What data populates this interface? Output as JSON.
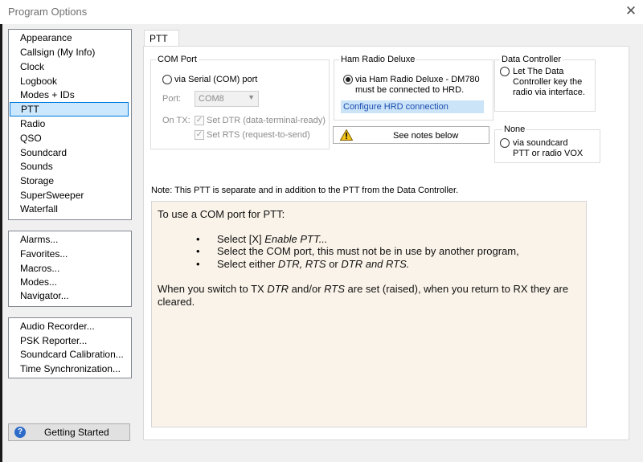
{
  "window": {
    "title": "Program Options",
    "close_glyph": "✕"
  },
  "nav_lists": {
    "main": [
      "Appearance",
      "Callsign (My Info)",
      "Clock",
      "Logbook",
      "Modes + IDs",
      "PTT",
      "Radio",
      "QSO",
      "Soundcard",
      "Sounds",
      "Storage",
      "SuperSweeper",
      "Waterfall"
    ],
    "selected": "PTT",
    "dialogs": [
      "Alarms...",
      "Favorites...",
      "Macros...",
      "Modes...",
      "Navigator..."
    ],
    "tools": [
      "Audio Recorder...",
      "PSK Reporter...",
      "Soundcard Calibration...",
      "Time Synchronization..."
    ]
  },
  "getting_started": {
    "label": "Getting Started",
    "icon": "help-icon",
    "icon_glyph": "?"
  },
  "tab": {
    "label": "PTT"
  },
  "com_port": {
    "title": "COM Port",
    "serial_label": "via Serial (COM) port",
    "port_label": "Port:",
    "port_value": "COM8",
    "on_tx_label": "On TX:",
    "dtr_label": "Set DTR (data-terminal-ready)",
    "rts_label": "Set RTS (request-to-send)",
    "dtr_checked": true,
    "rts_checked": true
  },
  "hrd": {
    "title": "Ham Radio Deluxe",
    "option_line1": "via Ham Radio Deluxe - DM780",
    "option_line2": "must be connected to HRD.",
    "selected": true,
    "configure_link": "Configure HRD connection"
  },
  "data_controller": {
    "title": "Data Controller",
    "line1": "Let The Data",
    "line2": "Controller key the",
    "line3": "radio via interface."
  },
  "none_group": {
    "title": "None",
    "line1": "via soundcard",
    "line2": "PTT or radio VOX"
  },
  "notes_button": {
    "label": "See notes below",
    "icon": "warning-icon"
  },
  "note_line": "Note: This PTT is separate and in addition to the PTT from the Data Controller.",
  "notes": {
    "intro": "To use a COM port for PTT:",
    "bullet1_pre": "Select [X] ",
    "bullet1_em": "Enable PTT...",
    "bullet2": "Select the COM port, this must not be in use by another program,",
    "bullet3_pre": "Select either ",
    "bullet3_em1": "DTR, RTS",
    "bullet3_mid": " or ",
    "bullet3_em2": "DTR and RTS.",
    "para_a": "When you switch to TX ",
    "para_em1": "DTR",
    "para_b": " and/or ",
    "para_em2": "RTS",
    "para_c": " are set (raised), when you return to RX they are",
    "para_line2": "cleared."
  },
  "colors": {
    "selection": "#cce8ff",
    "notes_bg": "#faf3e9",
    "link": "#1a4db3"
  }
}
